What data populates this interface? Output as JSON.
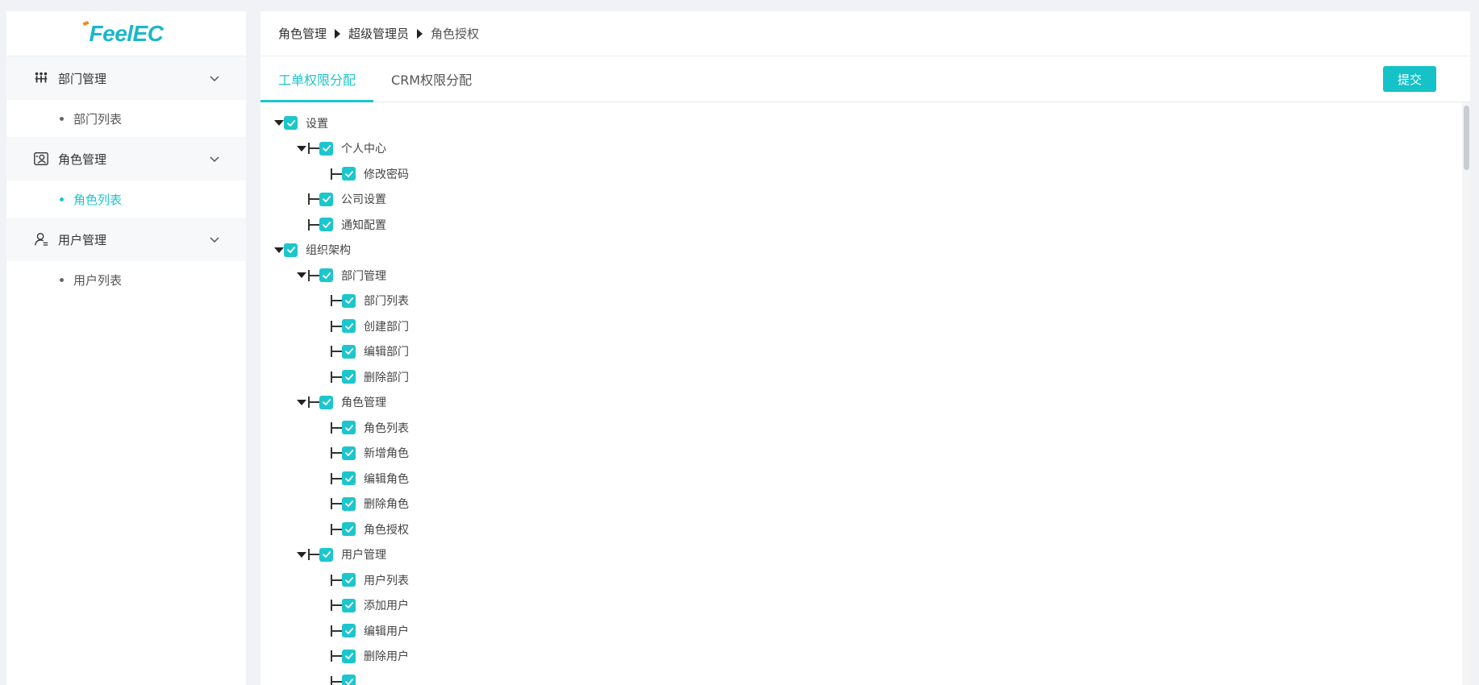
{
  "app": {
    "logo_text": "FeelEC"
  },
  "colors": {
    "accent": "#1cc6cc",
    "button": "#14c2c8"
  },
  "sidebar": {
    "groups": [
      {
        "label": "部门管理",
        "icon": "department-icon",
        "items": [
          {
            "label": "部门列表",
            "active": false
          }
        ]
      },
      {
        "label": "角色管理",
        "icon": "role-card-icon",
        "items": [
          {
            "label": "角色列表",
            "active": true
          }
        ]
      },
      {
        "label": "用户管理",
        "icon": "user-icon",
        "items": [
          {
            "label": "用户列表",
            "active": false
          }
        ]
      }
    ]
  },
  "breadcrumb": {
    "items": [
      "角色管理",
      "超级管理员",
      "角色授权"
    ]
  },
  "tabs": [
    {
      "label": "工单权限分配",
      "active": true
    },
    {
      "label": "CRM权限分配",
      "active": false
    }
  ],
  "submit_label": "提交",
  "tree": [
    {
      "label": "设置",
      "level": 0,
      "expandable": true,
      "checked": true
    },
    {
      "label": "个人中心",
      "level": 1,
      "expandable": true,
      "checked": true
    },
    {
      "label": "修改密码",
      "level": 2,
      "expandable": false,
      "checked": true
    },
    {
      "label": "公司设置",
      "level": 1,
      "expandable": false,
      "checked": true
    },
    {
      "label": "通知配置",
      "level": 1,
      "expandable": false,
      "checked": true
    },
    {
      "label": "组织架构",
      "level": 0,
      "expandable": true,
      "checked": true
    },
    {
      "label": "部门管理",
      "level": 1,
      "expandable": true,
      "checked": true
    },
    {
      "label": "部门列表",
      "level": 2,
      "expandable": false,
      "checked": true
    },
    {
      "label": "创建部门",
      "level": 2,
      "expandable": false,
      "checked": true
    },
    {
      "label": "编辑部门",
      "level": 2,
      "expandable": false,
      "checked": true
    },
    {
      "label": "删除部门",
      "level": 2,
      "expandable": false,
      "checked": true
    },
    {
      "label": "角色管理",
      "level": 1,
      "expandable": true,
      "checked": true
    },
    {
      "label": "角色列表",
      "level": 2,
      "expandable": false,
      "checked": true
    },
    {
      "label": "新增角色",
      "level": 2,
      "expandable": false,
      "checked": true
    },
    {
      "label": "编辑角色",
      "level": 2,
      "expandable": false,
      "checked": true
    },
    {
      "label": "删除角色",
      "level": 2,
      "expandable": false,
      "checked": true
    },
    {
      "label": "角色授权",
      "level": 2,
      "expandable": false,
      "checked": true
    },
    {
      "label": "用户管理",
      "level": 1,
      "expandable": true,
      "checked": true
    },
    {
      "label": "用户列表",
      "level": 2,
      "expandable": false,
      "checked": true
    },
    {
      "label": "添加用户",
      "level": 2,
      "expandable": false,
      "checked": true
    },
    {
      "label": "编辑用户",
      "level": 2,
      "expandable": false,
      "checked": true
    },
    {
      "label": "删除用户",
      "level": 2,
      "expandable": false,
      "checked": true
    },
    {
      "label": "",
      "level": 2,
      "expandable": false,
      "checked": true
    }
  ]
}
